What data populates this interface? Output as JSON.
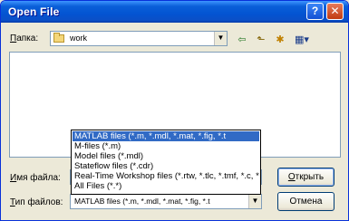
{
  "window": {
    "title": "Open File"
  },
  "titlebar": {
    "help_glyph": "?",
    "close_glyph": "✕"
  },
  "location": {
    "label_first": "П",
    "label_rest": "апка:",
    "value": "work",
    "arrow": "▼"
  },
  "toolbar": {
    "back_glyph": "⇦",
    "up_glyph": "⬑",
    "newfolder_glyph": "✱",
    "views_glyph": "▦▾",
    "icons": [
      "back-icon",
      "up-folder-icon",
      "new-folder-icon",
      "view-menu-icon"
    ]
  },
  "filename": {
    "label_first": "И",
    "label_rest": "мя файла:",
    "value": ""
  },
  "filetype": {
    "label_first": "Т",
    "label_rest": "ип файлов:",
    "value": "MATLAB files (*.m, *.mdl, *.mat, *.fig, *.t",
    "arrow": "▼",
    "options": [
      "MATLAB files (*.m, *.mdl, *.mat, *.fig, *.t",
      "M-files (*.m)",
      "Model files (*.mdl)",
      "Stateflow files (*.cdr)",
      "Real-Time Workshop files (*.rtw, *.tlc, *.tmf, *.c, *",
      "All Files (*.*)"
    ],
    "selected_index": 0
  },
  "buttons": {
    "open_first": "О",
    "open_rest": "ткрыть",
    "cancel": "Отмена"
  }
}
